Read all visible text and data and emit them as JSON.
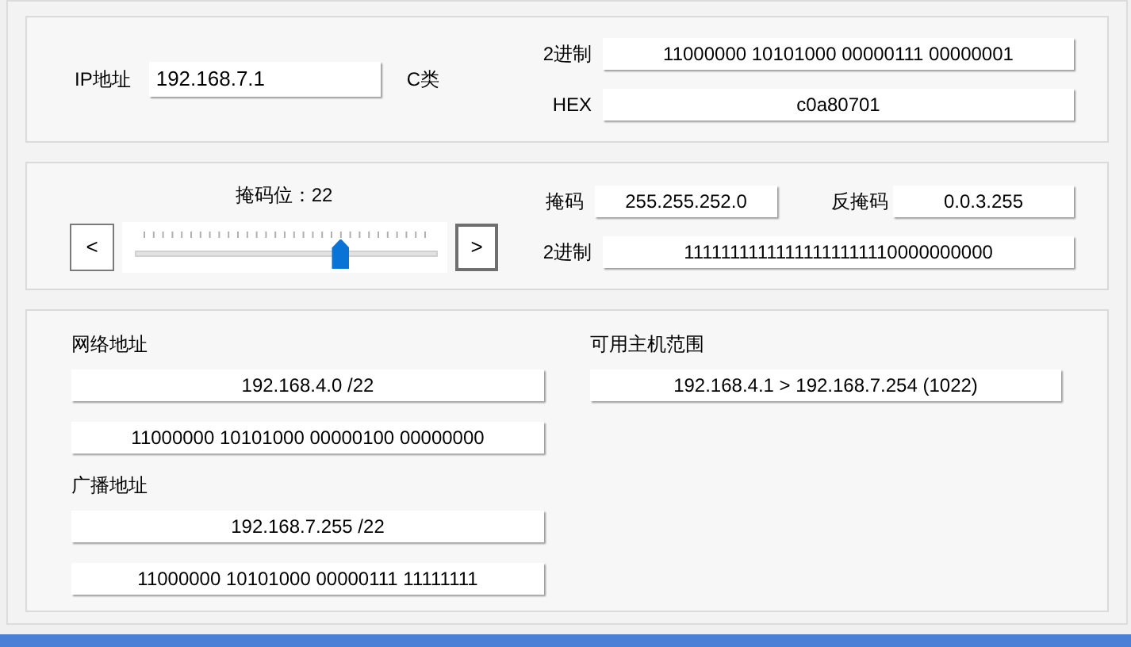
{
  "ip": {
    "label": "IP地址",
    "value": "192.168.7.1",
    "class": "C类",
    "binary": {
      "label": "2进制",
      "value": "11000000 10101000 00000111 00000001"
    },
    "hex": {
      "label": "HEX",
      "value": "c0a80701"
    }
  },
  "mask": {
    "title": "掩码位：22",
    "prev": "<",
    "next": ">",
    "level": 0.6875,
    "mask": {
      "label": "掩码",
      "value": "255.255.252.0"
    },
    "inverse": {
      "label": "反掩码",
      "value": "0.0.3.255"
    },
    "binary": {
      "label": "2进制",
      "value": "11111111111111111111110000000000"
    }
  },
  "network": {
    "label": "网络地址",
    "value": "192.168.4.0 /22",
    "binary": "11000000 10101000 00000100 00000000"
  },
  "broadcast": {
    "label": "广播地址",
    "value": "192.168.7.255 /22",
    "binary": "11000000 10101000 00000111 11111111"
  },
  "hosts": {
    "label": "可用主机范围",
    "value": "192.168.4.1 > 192.168.7.254 (1022)"
  }
}
